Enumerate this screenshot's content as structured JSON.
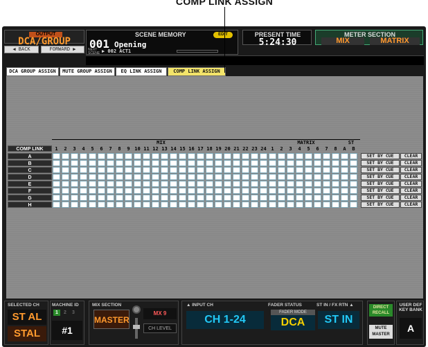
{
  "callout": {
    "label": "COMP LINK ASSIGN"
  },
  "output": {
    "tag": "OUTPUT",
    "value": "DCA/GROUP",
    "back_label": "◀ BACK",
    "forward_label": "FORWARD ▶"
  },
  "scene": {
    "title": "SCENE MEMORY",
    "edit_badge": "EDIT",
    "number": "001",
    "name": "Opening",
    "next_label": "NEXT SCENE",
    "next_value": "▶ 002 ACT1"
  },
  "present_time": {
    "title": "PRESENT TIME",
    "value": "5:24:30"
  },
  "meter_section": {
    "title": "METER SECTION",
    "mix": "MIX",
    "matrix": "MATRIX"
  },
  "tabs": [
    {
      "label": "DCA GROUP ASSIGN",
      "active": false
    },
    {
      "label": "MUTE GROUP ASSIGN",
      "active": false
    },
    {
      "label": "EQ LINK ASSIGN",
      "active": false
    },
    {
      "label": "COMP LINK ASSIGN",
      "active": true
    }
  ],
  "grid": {
    "group_mix": "MIX",
    "group_matrix": "MATRIX",
    "group_st": "ST",
    "corner_label": "COMP LINK",
    "mix_columns": [
      "1",
      "2",
      "3",
      "4",
      "5",
      "6",
      "7",
      "8",
      "9",
      "10",
      "11",
      "12",
      "13",
      "14",
      "15",
      "16",
      "17",
      "18",
      "19",
      "20",
      "21",
      "22",
      "23",
      "24"
    ],
    "matrix_columns": [
      "1",
      "2",
      "3",
      "4",
      "5",
      "6",
      "7",
      "8"
    ],
    "st_columns": [
      "A",
      "B"
    ],
    "rows": [
      "A",
      "B",
      "C",
      "D",
      "E",
      "F",
      "G",
      "H"
    ],
    "set_by_cue_label": "SET BY CUE",
    "clear_label": "CLEAR"
  },
  "bottom": {
    "selected_ch_title": "SELECTED CH",
    "selected_ch_value": "ST AL",
    "selected_ch_name": "STAL",
    "machine_id_title": "MACHINE ID",
    "machine_id_slots": [
      "1",
      "2",
      "3"
    ],
    "machine_id_value": "#1",
    "mix_section_title": "MIX SECTION",
    "mix_section_value": "MASTER",
    "mix_channel": "MX 9",
    "ch_level": "CH LEVEL",
    "input_ch_title": "▲ INPUT CH",
    "input_ch_value": "CH 1-24",
    "fader_status_title": "FADER STATUS",
    "fader_mode_label": "FADER MODE",
    "fader_mode_value": "DCA",
    "st_in_title": "ST IN / FX RTN ▲",
    "st_in_value": "ST IN",
    "direct_recall": "DIRECT RECALL",
    "mute_master": "MUTE MASTER",
    "user_def_title": "USER DEF KEY BANK",
    "user_def_value": "A"
  }
}
